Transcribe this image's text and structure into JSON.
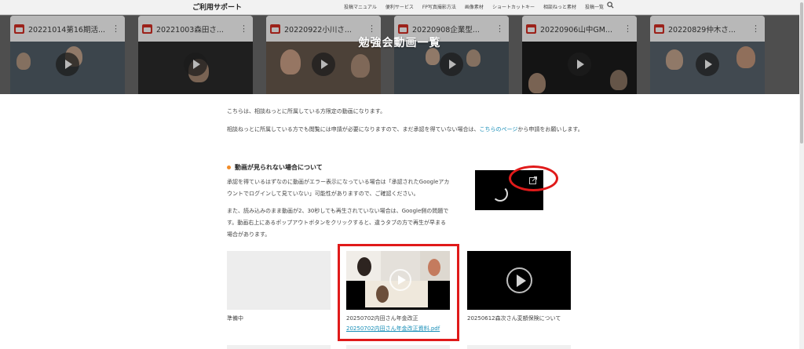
{
  "header": {
    "brand": "ご利用サポート",
    "nav": [
      "投稿マニュアル",
      "便利サービス",
      "FP写真撮影方法",
      "画像素材",
      "ショートカットキー",
      "相談ねっと素材",
      "投稿一覧"
    ],
    "search_icon": "search-icon"
  },
  "hero": {
    "title": "勉強会動画一覧",
    "videos": [
      {
        "title": "20221014第16期活..."
      },
      {
        "title": "20221003森田さ..."
      },
      {
        "title": "20220922小川さ..."
      },
      {
        "title": "20220908企業型..."
      },
      {
        "title": "20220906山中GM..."
      },
      {
        "title": "20220829仲木さ..."
      }
    ]
  },
  "intro": {
    "line1": "こちらは、相談ねっとに所属している方限定の動画になります。",
    "line2_before": "相談ねっとに所属している方でも閲覧には申請が必要になりますので、まだ承認を得ていない場合は、",
    "line2_link": "こちらのページ",
    "line2_after": "から申請をお願いします。"
  },
  "notice": {
    "heading": "動画が見られない場合について",
    "p1": "承認を得ているはずなのに動画がエラー表示になっている場合は「承認されたGoogleアカウントでログインして見ていない」可能性がありますので、ご確認ください。",
    "p2": "また、読み込みのまま動画が2、30秒しても再生されていない場合は、Google側の問題です。動画右上にあるポップアウトボタンをクリックすると、違うタブの方で再生が早まる場合があります。"
  },
  "videos": [
    {
      "caption": "準備中",
      "state": "placeholder"
    },
    {
      "caption": "20250702内田さん年金改正",
      "attachment": "20250702内田さん年金改正資料.pdf",
      "state": "thumbnail"
    },
    {
      "caption": "20250612森次さん変額保険について",
      "state": "player"
    }
  ],
  "colors": {
    "accent_link": "#1a8fb8",
    "highlight_red": "#e01a1a",
    "bullet_orange": "#f28c28",
    "calendar_red": "#d93025"
  }
}
